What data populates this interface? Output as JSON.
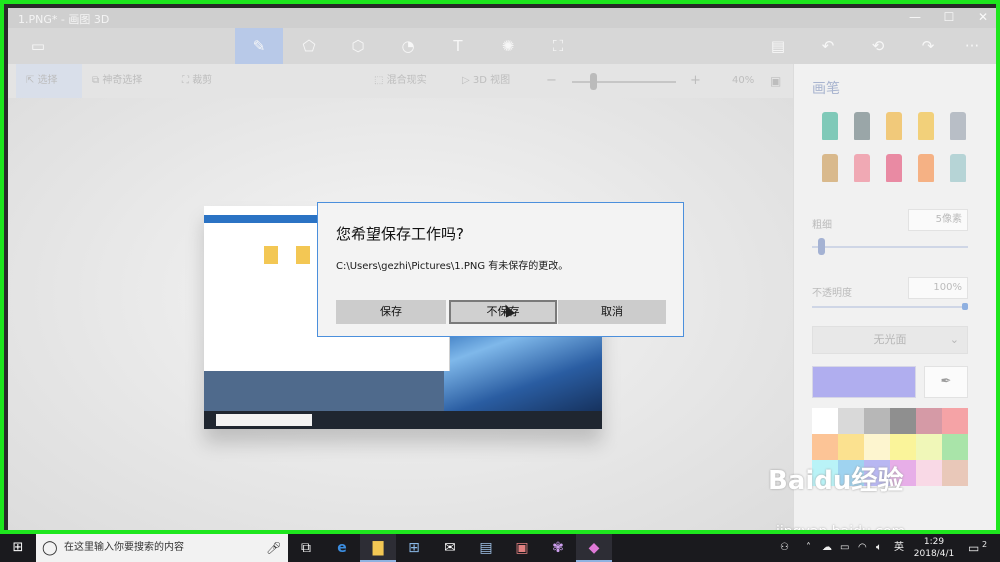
{
  "window": {
    "title": "1.PNG* - 画图 3D",
    "controls": [
      "—",
      "☐",
      "✕"
    ]
  },
  "toolbar": {
    "items": [
      {
        "name": "menu-icon",
        "glyph": "▭"
      },
      {
        "name": "brush-icon",
        "glyph": "✎",
        "active": true
      },
      {
        "name": "2d-shapes-icon",
        "glyph": "⬠"
      },
      {
        "name": "3d-shapes-icon",
        "glyph": "⬡"
      },
      {
        "name": "stickers-icon",
        "glyph": "◔"
      },
      {
        "name": "text-icon",
        "glyph": "T"
      },
      {
        "name": "effects-icon",
        "glyph": "✺"
      },
      {
        "name": "canvas-icon",
        "glyph": "⛶"
      }
    ],
    "right": [
      {
        "name": "paste-icon",
        "glyph": "▤"
      },
      {
        "name": "undo-icon",
        "glyph": "↶"
      },
      {
        "name": "history-icon",
        "glyph": "⟲"
      },
      {
        "name": "redo-icon",
        "glyph": "↷"
      },
      {
        "name": "more-icon",
        "glyph": "···"
      }
    ]
  },
  "subbar": {
    "select": "选择",
    "magic_select": "神奇选择",
    "crop": "裁剪",
    "mixed_reality": "混合现实",
    "view_3d": "3D 视图",
    "zoom_out": "−",
    "zoom_in": "+",
    "zoom": "40%",
    "zoom_level": 0.2
  },
  "dialog": {
    "title": "您希望保存工作吗?",
    "message": "C:\\Users\\gezhi\\Pictures\\1.PNG 有未保存的更改。",
    "save": "保存",
    "dont_save": "不保存",
    "cancel": "取消"
  },
  "panel": {
    "title": "画笔",
    "thickness_label": "粗细",
    "thickness_value": "5像素",
    "thickness_level": 0.04,
    "opacity_label": "不透明度",
    "opacity_value": "100%",
    "opacity_level": 1.0,
    "material": "无光面",
    "brush_colors": [
      "#7fc9b8",
      "#9aa6a8",
      "#f1c97a",
      "#f2d07a",
      "#b8bec6",
      "#d9b98c",
      "#f0a9b4",
      "#e98aa3",
      "#f5b184",
      "#b6d4d6"
    ],
    "current_color": "#b0aeef",
    "palette": [
      "#ffffff",
      "#d9d9d9",
      "#b7b7b7",
      "#8f8f8f",
      "#d59aa6",
      "#f5a3a6",
      "#fcc496",
      "#fbe18f",
      "#fdf5cf",
      "#faf49a",
      "#f0f7b8",
      "#a9e4a9",
      "#b9f3f7",
      "#9fd3f0",
      "#b8b7f2",
      "#e7aee8",
      "#f9d9e6",
      "#e9c8b9"
    ]
  },
  "taskbar": {
    "search_placeholder": "在这里输入你要搜索的内容",
    "ime": "英",
    "time": "1:29",
    "date": "2018/4/1",
    "notifications": "2"
  },
  "watermark": {
    "brand": "Baidu经验",
    "url": "jingyan.baidu.com"
  }
}
